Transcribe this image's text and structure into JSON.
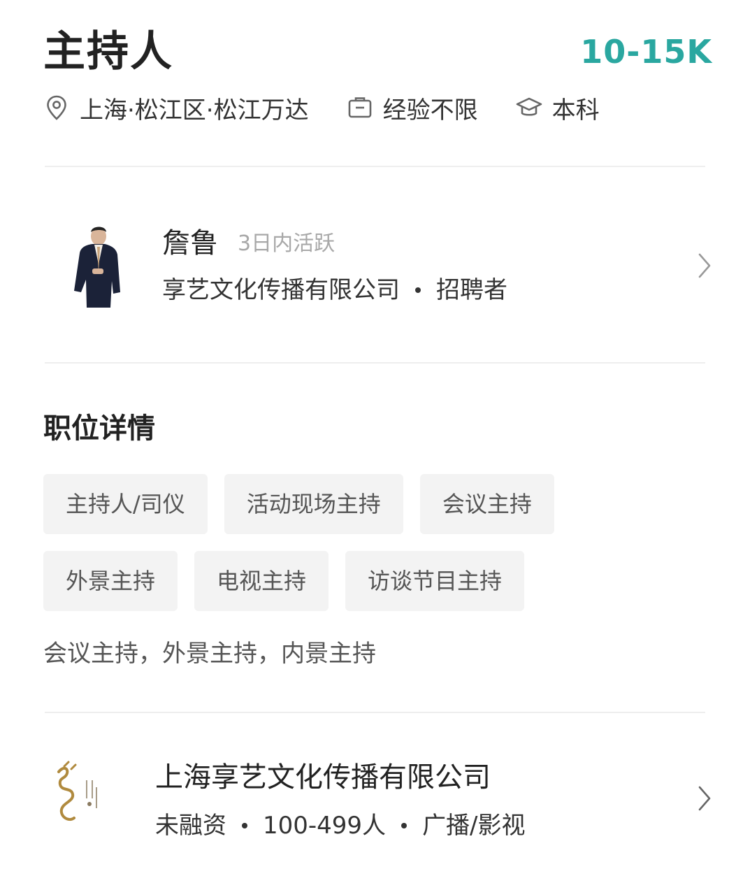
{
  "job": {
    "title": "主持人",
    "salary": "10-15K",
    "location": "上海·松江区·松江万达",
    "experience": "经验不限",
    "education": "本科",
    "icons": {
      "location": "location-pin-icon",
      "experience": "briefcase-icon",
      "education": "graduation-cap-icon"
    }
  },
  "recruiter": {
    "name": "詹鲁",
    "status": "3日内活跃",
    "company": "享艺文化传播有限公司",
    "role": "招聘者",
    "avatar_icon": "recruiter-avatar-icon"
  },
  "details": {
    "section_title": "职位详情",
    "tags": [
      [
        "主持人/司仪",
        "活动现场主持",
        "会议主持"
      ],
      [
        "外景主持",
        "电视主持",
        "访谈节目主持"
      ]
    ],
    "description": "会议主持，外景主持，内景主持"
  },
  "company": {
    "name": "上海享艺文化传播有限公司",
    "funding": "未融资",
    "size": "100-499人",
    "industry": "广播/影视",
    "logo_icon": "company-logo-icon"
  },
  "colors": {
    "salary": "#2aa7a0",
    "primary_text": "#222222",
    "secondary_text": "#555555",
    "muted_text": "#a8a8a8",
    "tag_bg": "#f3f3f3",
    "divider": "#eeeeee"
  }
}
